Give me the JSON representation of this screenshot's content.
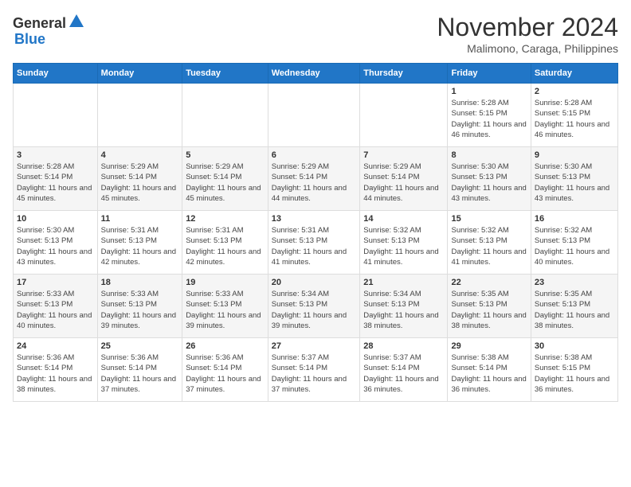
{
  "logo": {
    "general": "General",
    "blue": "Blue"
  },
  "title": "November 2024",
  "subtitle": "Malimono, Caraga, Philippines",
  "days_of_week": [
    "Sunday",
    "Monday",
    "Tuesday",
    "Wednesday",
    "Thursday",
    "Friday",
    "Saturday"
  ],
  "weeks": [
    [
      {
        "day": "",
        "info": ""
      },
      {
        "day": "",
        "info": ""
      },
      {
        "day": "",
        "info": ""
      },
      {
        "day": "",
        "info": ""
      },
      {
        "day": "",
        "info": ""
      },
      {
        "day": "1",
        "info": "Sunrise: 5:28 AM\nSunset: 5:15 PM\nDaylight: 11 hours and 46 minutes."
      },
      {
        "day": "2",
        "info": "Sunrise: 5:28 AM\nSunset: 5:15 PM\nDaylight: 11 hours and 46 minutes."
      }
    ],
    [
      {
        "day": "3",
        "info": "Sunrise: 5:28 AM\nSunset: 5:14 PM\nDaylight: 11 hours and 45 minutes."
      },
      {
        "day": "4",
        "info": "Sunrise: 5:29 AM\nSunset: 5:14 PM\nDaylight: 11 hours and 45 minutes."
      },
      {
        "day": "5",
        "info": "Sunrise: 5:29 AM\nSunset: 5:14 PM\nDaylight: 11 hours and 45 minutes."
      },
      {
        "day": "6",
        "info": "Sunrise: 5:29 AM\nSunset: 5:14 PM\nDaylight: 11 hours and 44 minutes."
      },
      {
        "day": "7",
        "info": "Sunrise: 5:29 AM\nSunset: 5:14 PM\nDaylight: 11 hours and 44 minutes."
      },
      {
        "day": "8",
        "info": "Sunrise: 5:30 AM\nSunset: 5:13 PM\nDaylight: 11 hours and 43 minutes."
      },
      {
        "day": "9",
        "info": "Sunrise: 5:30 AM\nSunset: 5:13 PM\nDaylight: 11 hours and 43 minutes."
      }
    ],
    [
      {
        "day": "10",
        "info": "Sunrise: 5:30 AM\nSunset: 5:13 PM\nDaylight: 11 hours and 43 minutes."
      },
      {
        "day": "11",
        "info": "Sunrise: 5:31 AM\nSunset: 5:13 PM\nDaylight: 11 hours and 42 minutes."
      },
      {
        "day": "12",
        "info": "Sunrise: 5:31 AM\nSunset: 5:13 PM\nDaylight: 11 hours and 42 minutes."
      },
      {
        "day": "13",
        "info": "Sunrise: 5:31 AM\nSunset: 5:13 PM\nDaylight: 11 hours and 41 minutes."
      },
      {
        "day": "14",
        "info": "Sunrise: 5:32 AM\nSunset: 5:13 PM\nDaylight: 11 hours and 41 minutes."
      },
      {
        "day": "15",
        "info": "Sunrise: 5:32 AM\nSunset: 5:13 PM\nDaylight: 11 hours and 41 minutes."
      },
      {
        "day": "16",
        "info": "Sunrise: 5:32 AM\nSunset: 5:13 PM\nDaylight: 11 hours and 40 minutes."
      }
    ],
    [
      {
        "day": "17",
        "info": "Sunrise: 5:33 AM\nSunset: 5:13 PM\nDaylight: 11 hours and 40 minutes."
      },
      {
        "day": "18",
        "info": "Sunrise: 5:33 AM\nSunset: 5:13 PM\nDaylight: 11 hours and 39 minutes."
      },
      {
        "day": "19",
        "info": "Sunrise: 5:33 AM\nSunset: 5:13 PM\nDaylight: 11 hours and 39 minutes."
      },
      {
        "day": "20",
        "info": "Sunrise: 5:34 AM\nSunset: 5:13 PM\nDaylight: 11 hours and 39 minutes."
      },
      {
        "day": "21",
        "info": "Sunrise: 5:34 AM\nSunset: 5:13 PM\nDaylight: 11 hours and 38 minutes."
      },
      {
        "day": "22",
        "info": "Sunrise: 5:35 AM\nSunset: 5:13 PM\nDaylight: 11 hours and 38 minutes."
      },
      {
        "day": "23",
        "info": "Sunrise: 5:35 AM\nSunset: 5:13 PM\nDaylight: 11 hours and 38 minutes."
      }
    ],
    [
      {
        "day": "24",
        "info": "Sunrise: 5:36 AM\nSunset: 5:14 PM\nDaylight: 11 hours and 38 minutes."
      },
      {
        "day": "25",
        "info": "Sunrise: 5:36 AM\nSunset: 5:14 PM\nDaylight: 11 hours and 37 minutes."
      },
      {
        "day": "26",
        "info": "Sunrise: 5:36 AM\nSunset: 5:14 PM\nDaylight: 11 hours and 37 minutes."
      },
      {
        "day": "27",
        "info": "Sunrise: 5:37 AM\nSunset: 5:14 PM\nDaylight: 11 hours and 37 minutes."
      },
      {
        "day": "28",
        "info": "Sunrise: 5:37 AM\nSunset: 5:14 PM\nDaylight: 11 hours and 36 minutes."
      },
      {
        "day": "29",
        "info": "Sunrise: 5:38 AM\nSunset: 5:14 PM\nDaylight: 11 hours and 36 minutes."
      },
      {
        "day": "30",
        "info": "Sunrise: 5:38 AM\nSunset: 5:15 PM\nDaylight: 11 hours and 36 minutes."
      }
    ]
  ]
}
